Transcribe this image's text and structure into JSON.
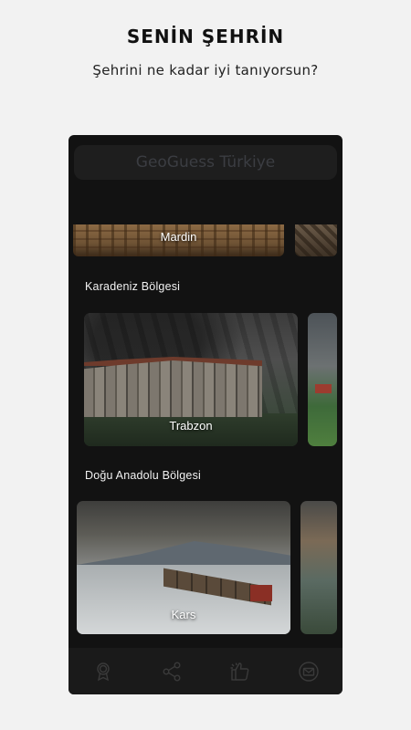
{
  "promo": {
    "title": "SENİN ŞEHRİN",
    "subtitle": "Şehrini ne kadar iyi tanıyorsun?"
  },
  "app": {
    "header_title": "GeoGuess Türkiye"
  },
  "sections": [
    {
      "title": "",
      "cities": [
        {
          "name": "Mardin"
        }
      ]
    },
    {
      "title": "Karadeniz Bölgesi",
      "cities": [
        {
          "name": "Trabzon"
        }
      ]
    },
    {
      "title": "Doğu Anadolu Bölgesi",
      "cities": [
        {
          "name": "Kars"
        }
      ]
    }
  ],
  "tabbar": {
    "icons": [
      "award-icon",
      "share-icon",
      "thumbs-up-icon",
      "mail-icon"
    ],
    "icon_color": "#3a3a3a"
  },
  "colors": {
    "page_bg": "#f2f2f2",
    "app_bg": "#121212",
    "header_bg": "#1e1e1e",
    "header_text": "#3b3d42",
    "text_light": "#f2f2f2"
  }
}
